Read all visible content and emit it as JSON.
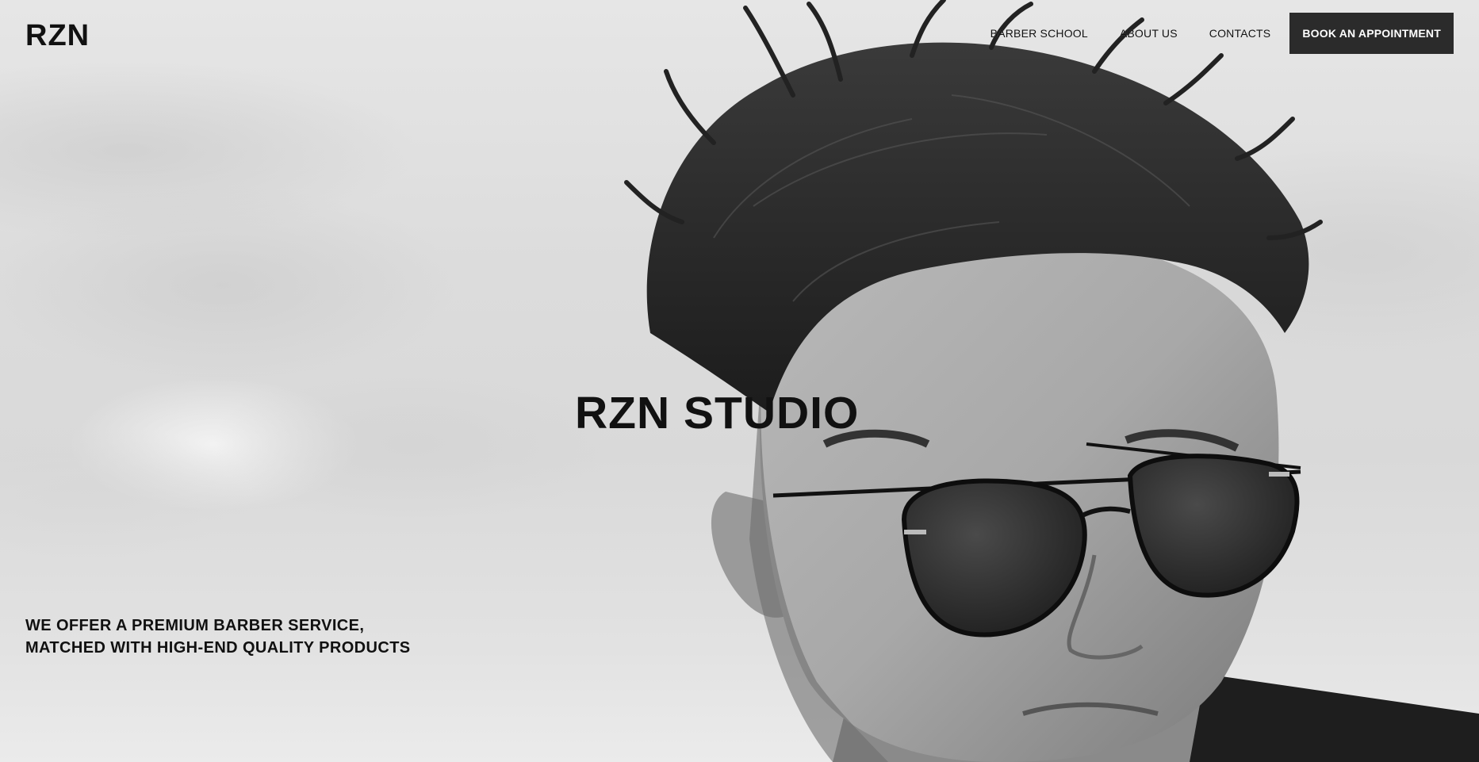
{
  "header": {
    "logo": "RZN",
    "nav": [
      {
        "label": "BARBER SCHOOL"
      },
      {
        "label": "ABOUT US"
      },
      {
        "label": "CONTACTS"
      }
    ],
    "cta_label": "BOOK AN APPOINTMENT"
  },
  "hero": {
    "title": "RZN STUDIO",
    "tagline_lines": [
      "WE OFFER A PREMIUM BARBER SERVICE,",
      "MATCHED WITH HIGH-END QUALITY PRODUCTS"
    ],
    "image": "black-and-white portrait of man with tousled hair and round sunglasses"
  },
  "colors": {
    "text": "#111111",
    "button_bg": "#2b2b2b",
    "button_text": "#ffffff",
    "background": "#e2e2e2"
  }
}
